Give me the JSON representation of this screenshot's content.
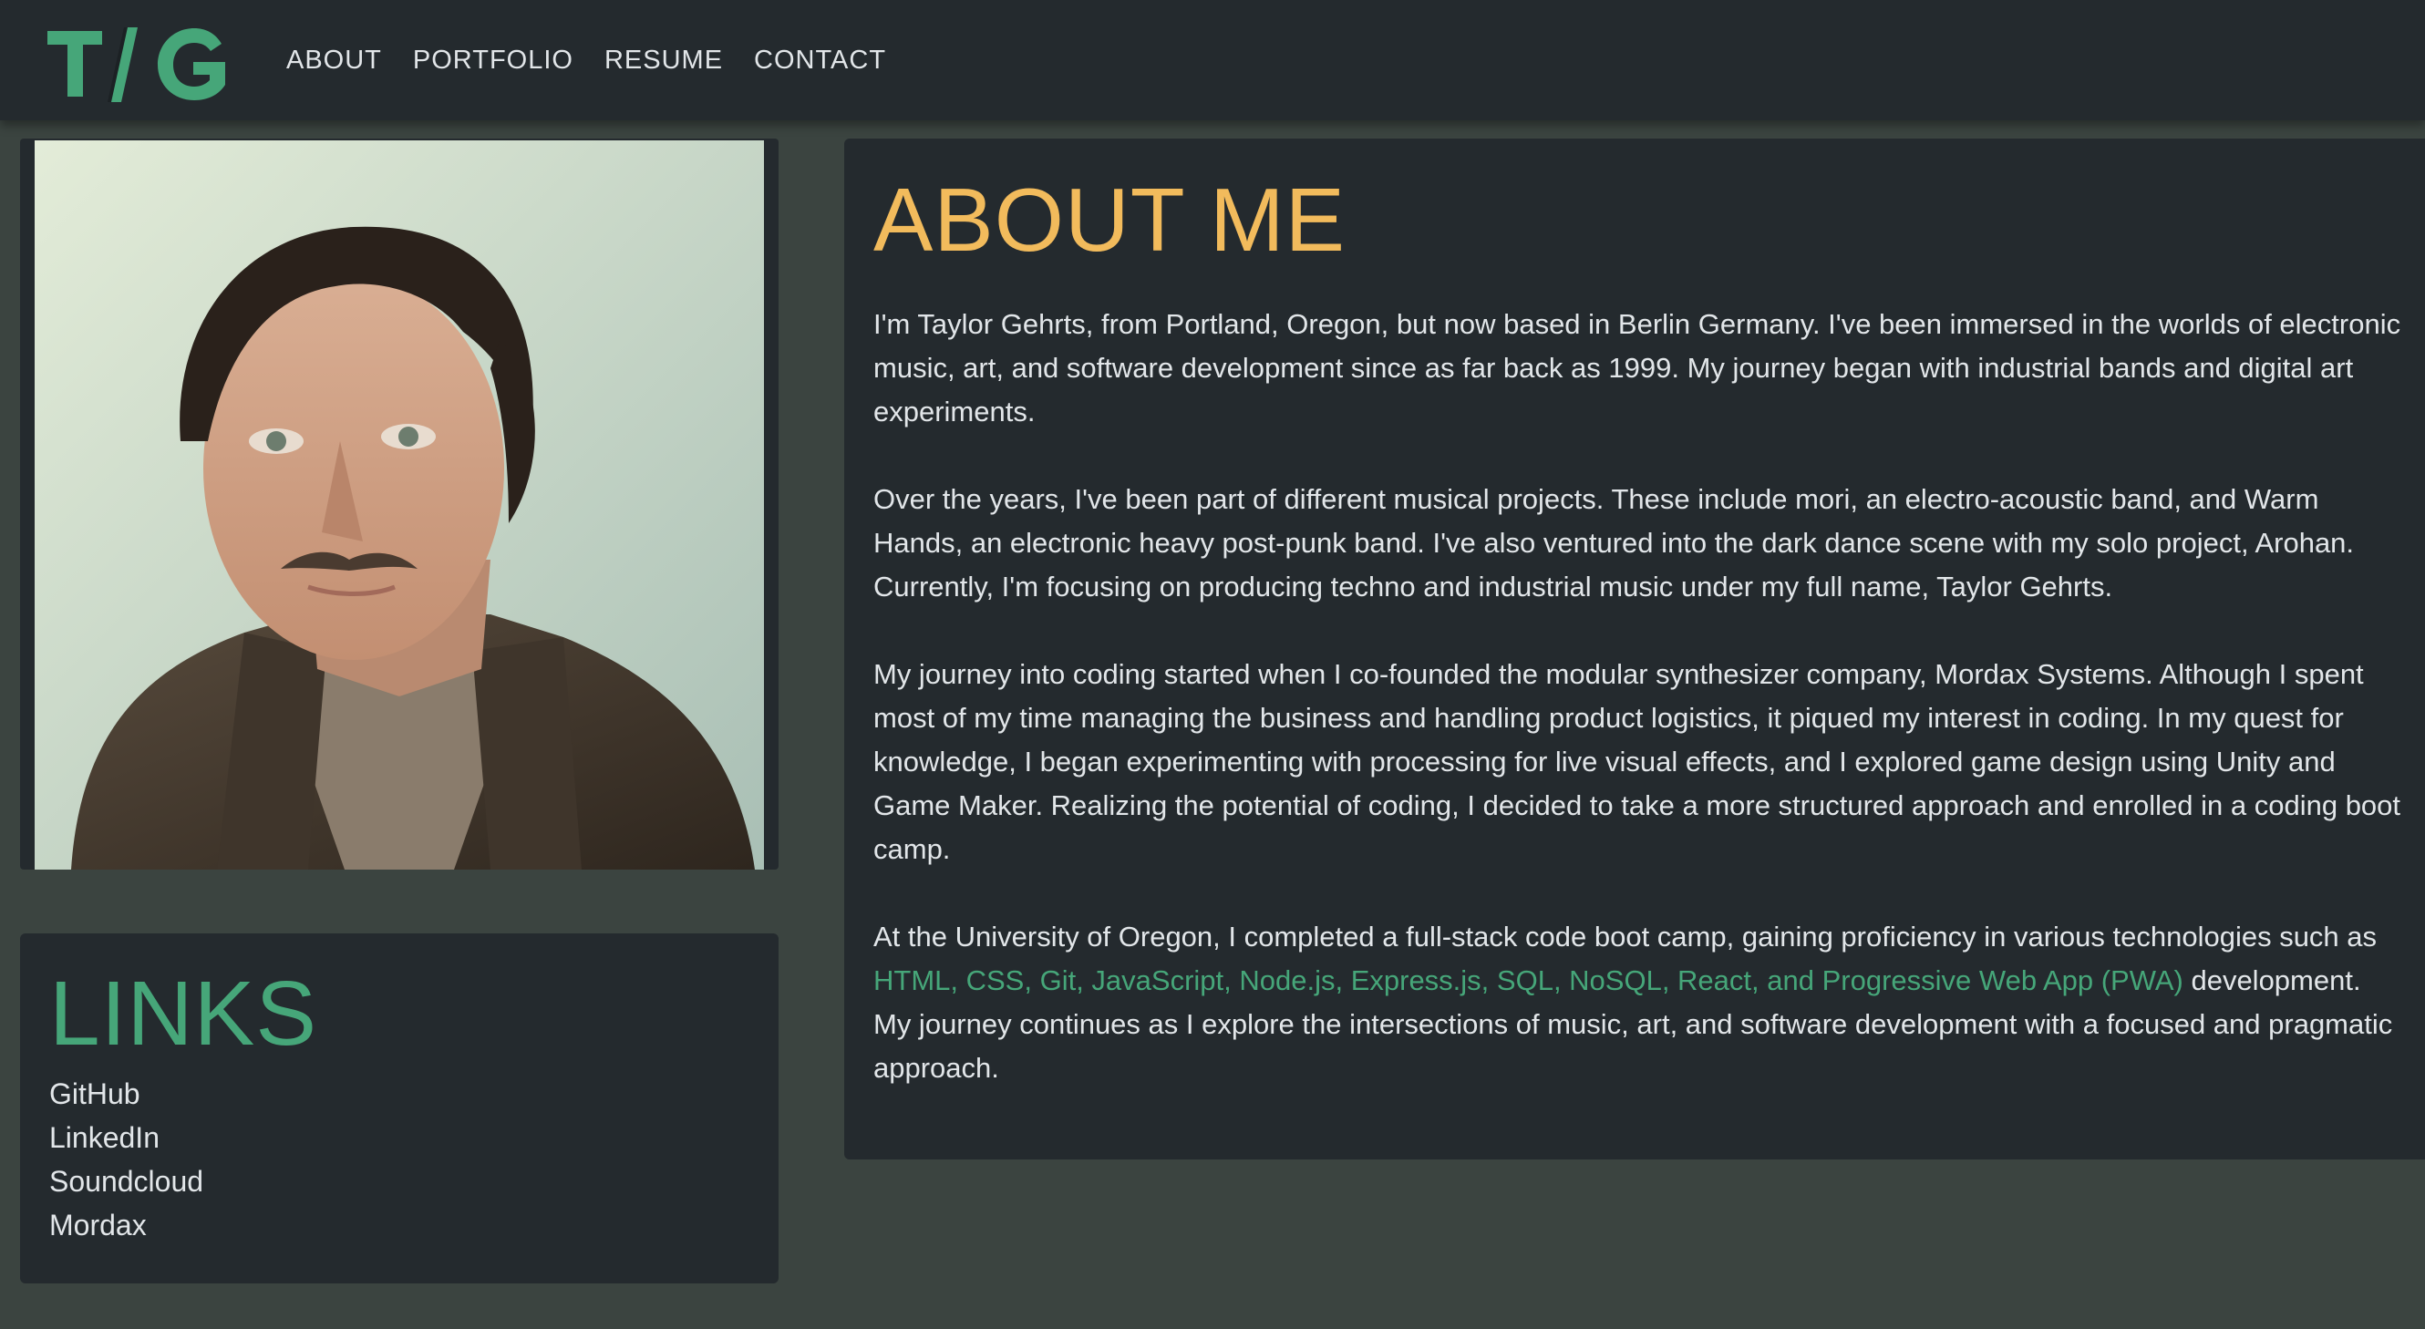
{
  "header": {
    "logo_text": "T/G",
    "nav": [
      "ABOUT",
      "PORTFOLIO",
      "RESUME",
      "CONTACT"
    ]
  },
  "links": {
    "heading": "LINKS",
    "items": [
      "GitHub",
      "LinkedIn",
      "Soundcloud",
      "Mordax"
    ]
  },
  "about": {
    "heading": "ABOUT ME",
    "p1": "I'm Taylor Gehrts, from Portland, Oregon, but now based in Berlin Germany. I've been immersed in the worlds of electronic music, art, and software development since as far back as 1999. My journey began with industrial bands and digital art experiments.",
    "p2": "Over the years, I've been part of different musical projects. These include mori, an electro-acoustic band, and Warm Hands, an electronic heavy post-punk band. I've also ventured into the dark dance scene with my solo project, Arohan. Currently, I'm focusing on producing techno and industrial music under my full name, Taylor Gehrts.",
    "p3": "My journey into coding started when I co-founded the modular synthesizer company, Mordax Systems. Although I spent most of my time managing the business and handling product logistics, it piqued my interest in coding. In my quest for knowledge, I began experimenting with processing for live visual effects, and I explored game design using Unity and Game Maker. Realizing the potential of coding, I decided to take a more structured approach and enrolled in a coding boot camp.",
    "p4_before": "At the University of Oregon, I completed a full-stack code boot camp, gaining proficiency in various technologies such as ",
    "p4_tech": "HTML, CSS, Git, JavaScript, Node.js, Express.js, SQL, NoSQL, React, and Progressive Web App (PWA)",
    "p4_after": " development. My journey continues as I explore the intersections of music, art, and software development with a focused and pragmatic approach."
  },
  "colors": {
    "page_bg": "#3b4440",
    "card_bg": "#242a2e",
    "accent_green": "#46a679",
    "accent_orange": "#f2bb5c",
    "text": "#e2e6e9"
  }
}
